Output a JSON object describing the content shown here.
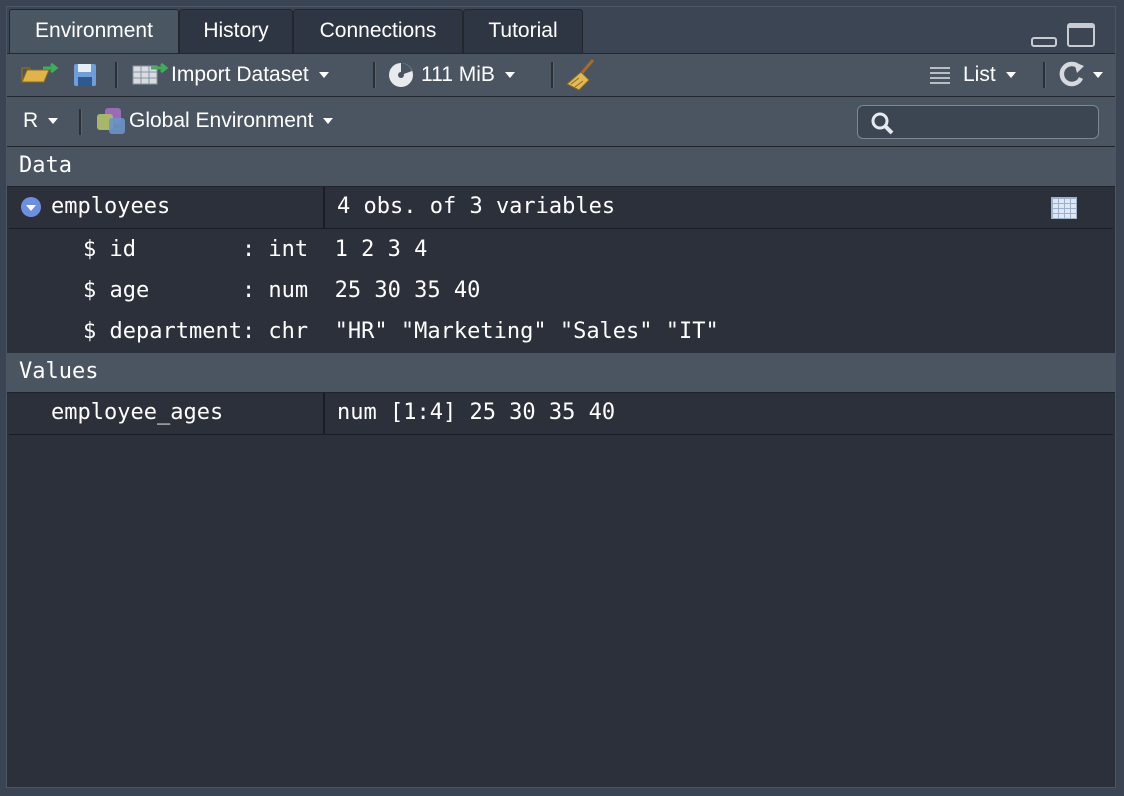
{
  "tabs": [
    {
      "label": "Environment",
      "active": true
    },
    {
      "label": "History",
      "active": false
    },
    {
      "label": "Connections",
      "active": false
    },
    {
      "label": "Tutorial",
      "active": false
    }
  ],
  "toolbar": {
    "import_dataset": "Import Dataset",
    "memory": "111 MiB",
    "view_mode": "List"
  },
  "envbar": {
    "language": "R",
    "environment": "Global Environment",
    "search_placeholder": ""
  },
  "sections": {
    "data": "Data",
    "values": "Values"
  },
  "data_items": [
    {
      "name": "employees",
      "summary": "4 obs. of 3 variables",
      "fields": [
        "$ id        : int  1 2 3 4",
        "$ age       : num  25 30 35 40",
        "$ department: chr  \"HR\" \"Marketing\" \"Sales\" \"IT\""
      ]
    }
  ],
  "value_items": [
    {
      "name": "employee_ages",
      "value": "num [1:4] 25 30 35 40"
    }
  ],
  "colors": {
    "background": "#2b303b",
    "header": "#4a5561",
    "accent": "#6e8fe0"
  }
}
